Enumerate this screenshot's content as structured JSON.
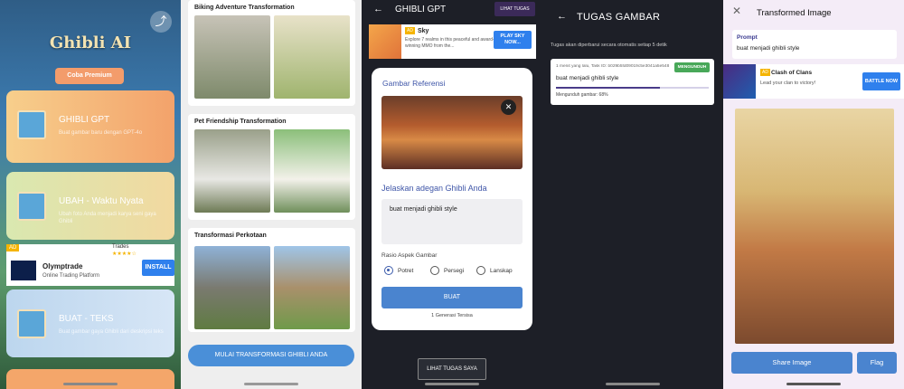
{
  "panel1": {
    "brand": "Ghibli AI",
    "share_icon": "share-icon",
    "premium_label": "Coba Premium",
    "cards": [
      {
        "title": "GHIBLI GPT",
        "desc": "Buat gambar baru dengan GPT-4o"
      },
      {
        "title": "UBAH - Waktu Nyata",
        "desc": "Ubah foto Anda menjadi karya seni gaya Ghibli"
      },
      {
        "title": "BUAT - TEKS",
        "desc": "Buat gambar gaya Ghibli dari deskripsi teks"
      }
    ],
    "ad": {
      "label": "AD",
      "name": "Olymptrade",
      "subtitle": "Online Trading Platform",
      "install": "INSTALL",
      "rating": "★★★★☆",
      "partial": "Trades"
    }
  },
  "panel2": {
    "cards": [
      {
        "title": "Biking Adventure Transformation"
      },
      {
        "title": "Pet Friendship Transformation"
      },
      {
        "title": "Transformasi Perkotaan"
      }
    ],
    "start_button": "MULAI TRANSFORMASI GHIBLI ANDA"
  },
  "panel3": {
    "title": "GHIBLI GPT",
    "lihat_tugas": "LIHAT TUGAS",
    "ad": {
      "label": "AD",
      "name": "Sky",
      "desc": "Explore 7 realms in this peaceful and award-winning MMO from the...",
      "button": "PLAY SKY NOW..."
    },
    "ref_label": "Gambar Referensi",
    "describe_label": "Jelaskan adegan Ghibli Anda",
    "textarea_value": "buat menjadi ghibli style",
    "aspect_label": "Rasio Aspek Gambar",
    "aspect_options": [
      "Potret",
      "Persegi",
      "Lanskap"
    ],
    "create_button": "BUAT",
    "generations_left": "1 Generasi Tersisa",
    "view_tasks_button": "LIHAT TUGAS SAYA"
  },
  "panel4": {
    "title": "TUGAS GAMBAR",
    "note": "Tugas akan diperbarui secara otomatis setiap 5 detik",
    "task": {
      "meta": "1 menit yang lalu, Task ID: b029b5fd09019c5e3041a5e548",
      "status": "MENGUNDUH",
      "prompt": "buat menjadi ghibli style",
      "progress": 0.68,
      "progress_text": "Mengunduh gambar: 68%"
    }
  },
  "panel5": {
    "title": "Transformed Image",
    "prompt_label": "Prompt",
    "prompt_text": "buat menjadi ghibli style",
    "ad": {
      "label": "AD",
      "name": "Clash of Clans",
      "subtitle": "Lead your clan to victory!",
      "button": "BATTLE NOW"
    },
    "share_button": "Share Image",
    "flag_button": "Flag"
  }
}
